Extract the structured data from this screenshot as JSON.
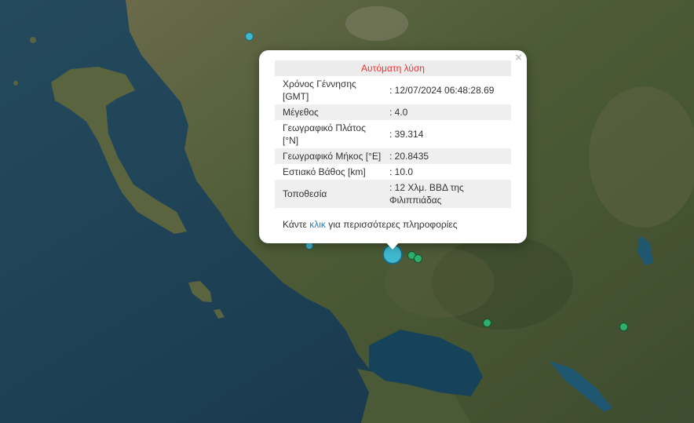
{
  "popup": {
    "close_glyph": "×",
    "title": "Αυτόματη λύση",
    "rows": [
      {
        "label": "Χρόνος Γέννησης [GMT]",
        "value": ": 12/07/2024 06:48:28.69"
      },
      {
        "label": "Μέγεθος",
        "value": ": 4.0"
      },
      {
        "label": "Γεωγραφικό Πλάτος [°N]",
        "value": ": 39.314"
      },
      {
        "label": "Γεωγραφικό Μήκος [°E]",
        "value": ": 20.8435"
      },
      {
        "label": "Εστιακό Βάθος [km]",
        "value": ": 10.0"
      },
      {
        "label": "Τοποθεσία",
        "value": ": 12 Χλμ. ΒΒΔ της Φιλιππιάδας"
      }
    ],
    "more_prefix": "Κάντε ",
    "more_link": "κλικ",
    "more_suffix": " για περισσότερες πληροφορίες"
  },
  "colors": {
    "sea": "#1d3f52",
    "land": "#4c5a36",
    "popup_title": "#e33333",
    "link": "#2a7ab0",
    "marker_blue": "#3fb8cf",
    "marker_green": "#2fae6e"
  },
  "icons": {
    "close": "close-icon"
  }
}
